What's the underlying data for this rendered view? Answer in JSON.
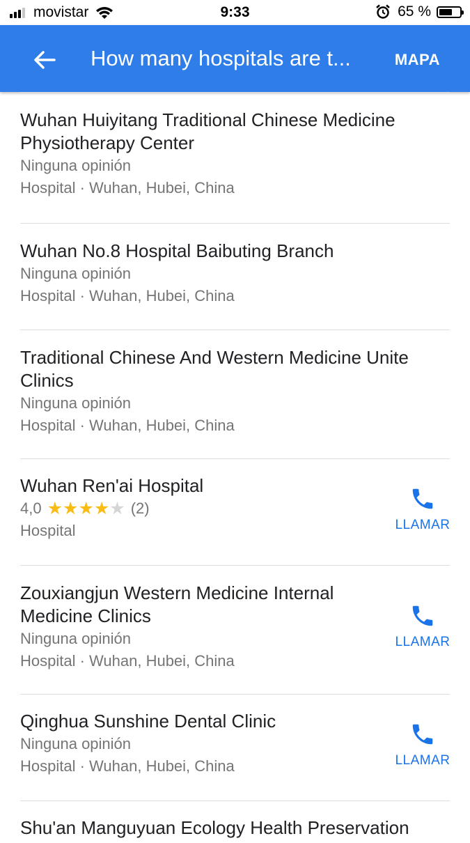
{
  "status_bar": {
    "carrier": "movistar",
    "time": "9:33",
    "battery_pct": "65 %",
    "battery_level": 0.65
  },
  "app_bar": {
    "title": "How many hospitals are t...",
    "map_label": "MAPA",
    "color": "#2f7de9"
  },
  "results": [
    {
      "name": "Wuhan Huiyitang Traditional Chinese Medicine Physiotherapy Center",
      "reviews": "Ninguna opinión",
      "details": "Hospital · Wuhan, Hubei, China"
    },
    {
      "name": "Wuhan No.8 Hospital Baibuting Branch",
      "reviews": "Ninguna opinión",
      "details": "Hospital · Wuhan, Hubei, China"
    },
    {
      "name": "Traditional Chinese And Western Medicine Unite Clinics",
      "reviews": "Ninguna opinión",
      "details": "Hospital · Wuhan, Hubei, China"
    },
    {
      "name": "Wuhan Ren'ai Hospital",
      "rating_value": "4,0",
      "rating_stars": 4,
      "rating_count": "(2)",
      "details": "Hospital",
      "call_label": "LLAMAR"
    },
    {
      "name": "Zouxiangjun Western Medicine Internal Medicine Clinics",
      "reviews": "Ninguna opinión",
      "details": "Hospital · Wuhan, Hubei, China",
      "call_label": "LLAMAR"
    },
    {
      "name": "Qinghua Sunshine Dental Clinic",
      "reviews": "Ninguna opinión",
      "details": "Hospital · Wuhan, Hubei, China",
      "call_label": "LLAMAR"
    },
    {
      "name": "Shu'an Manguyuan Ecology Health Preservation"
    }
  ],
  "colors": {
    "star": "#f9bc15",
    "call_blue": "#1a73e8"
  }
}
